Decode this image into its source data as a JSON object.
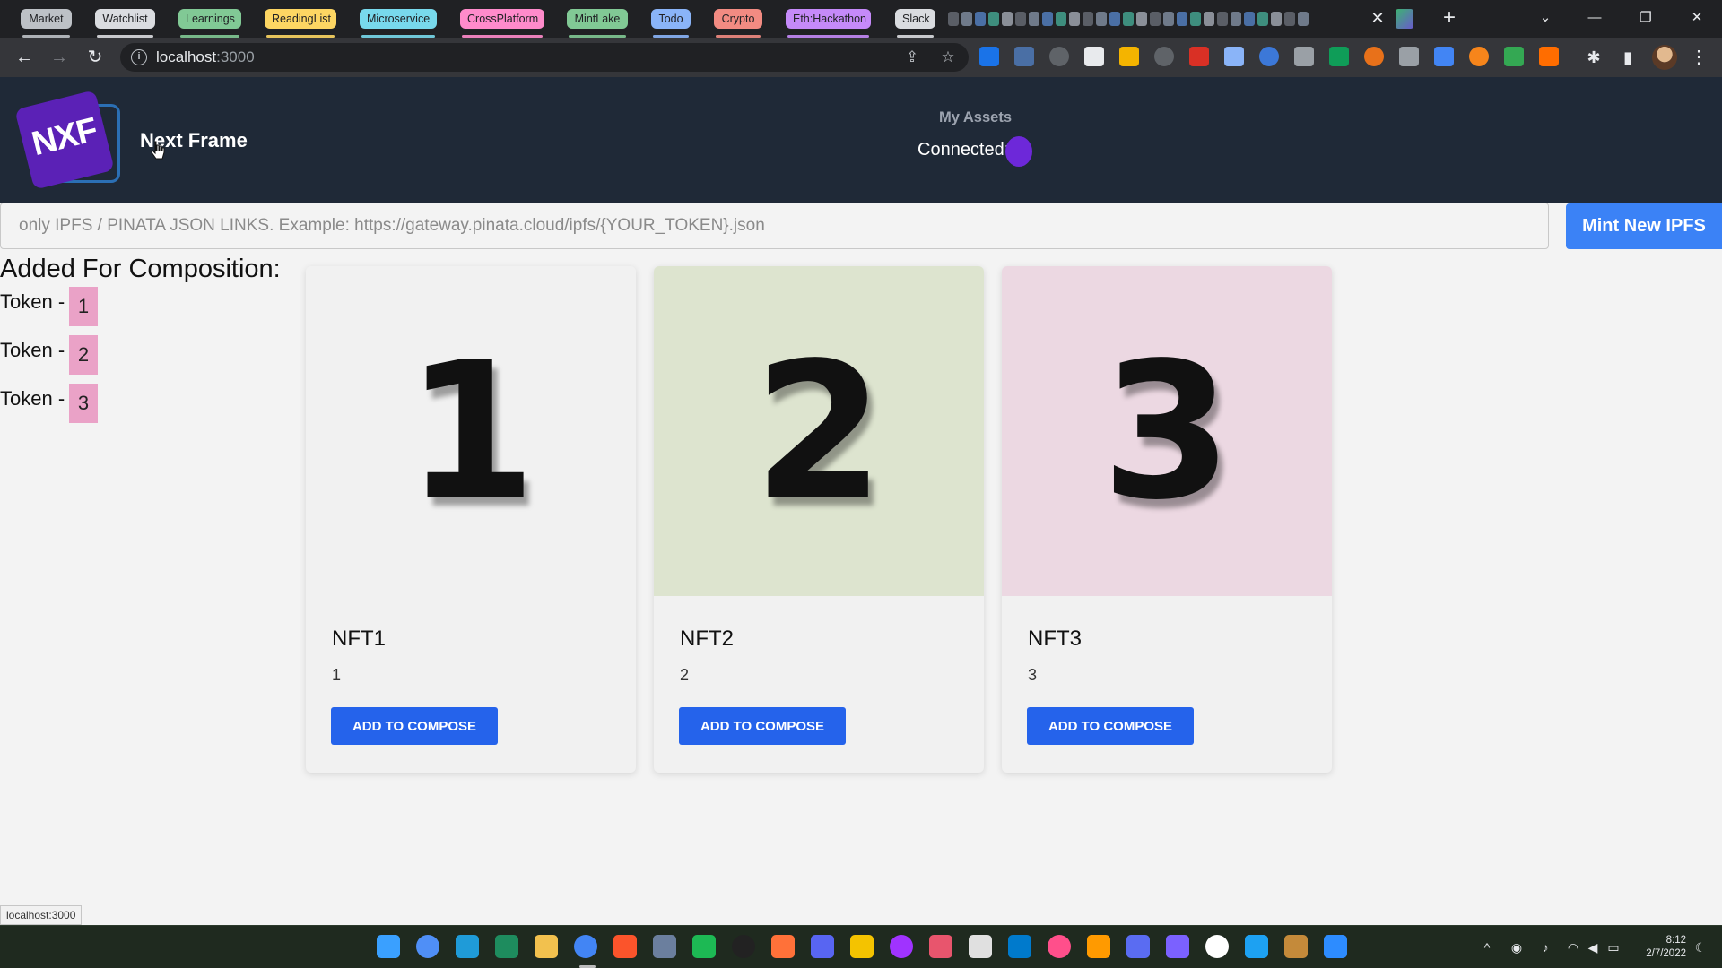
{
  "browser": {
    "tab_groups": [
      {
        "label": "Market",
        "color": "#bdc1c6",
        "text_color": "#202124"
      },
      {
        "label": "Watchlist",
        "color": "#dadce0",
        "text_color": "#202124"
      },
      {
        "label": "Learnings",
        "color": "#81c995",
        "text_color": "#202124"
      },
      {
        "label": "ReadingList",
        "color": "#fdd663",
        "text_color": "#202124"
      },
      {
        "label": "Microservice",
        "color": "#78d9ec",
        "text_color": "#202124"
      },
      {
        "label": "CrossPlatform",
        "color": "#ff8bcb",
        "text_color": "#202124"
      },
      {
        "label": "MintLake",
        "color": "#81c995",
        "text_color": "#202124"
      },
      {
        "label": "Todo",
        "color": "#8ab4f8",
        "text_color": "#202124"
      },
      {
        "label": "Crypto",
        "color": "#f28b82",
        "text_color": "#202124"
      },
      {
        "label": "Eth:Hackathon",
        "color": "#c58af9",
        "text_color": "#202124"
      },
      {
        "label": "Slack",
        "color": "#dadce0",
        "text_color": "#202124"
      }
    ],
    "address": {
      "host": "localhost",
      "port": ":3000"
    },
    "status_url": "localhost:3000"
  },
  "header": {
    "logo_text": "NXF",
    "brand_name": "Next Frame",
    "my_assets": "My Assets",
    "connected_label": "Connected:",
    "connected_color": "#6d28d9"
  },
  "mint": {
    "placeholder": "only IPFS / PINATA JSON LINKS. Example: https://gateway.pinata.cloud/ipfs/{YOUR_TOKEN}.json",
    "value": "",
    "button_label": "Mint New IPFS"
  },
  "composition": {
    "title": "Added For Composition:",
    "items": [
      {
        "label": "Token -",
        "token": "1"
      },
      {
        "label": "Token -",
        "token": "2"
      },
      {
        "label": "Token -",
        "token": "3"
      }
    ]
  },
  "nfts": [
    {
      "digit": "1",
      "name": "NFT1",
      "value": "1",
      "button": "ADD TO COMPOSE",
      "bg": "#f1f1f1"
    },
    {
      "digit": "2",
      "name": "NFT2",
      "value": "2",
      "button": "ADD TO COMPOSE",
      "bg": "#dde4cf"
    },
    {
      "digit": "3",
      "name": "NFT3",
      "value": "3",
      "button": "ADD TO COMPOSE",
      "bg": "#ecd8e2"
    }
  ],
  "taskbar": {
    "clock_time": "8:12",
    "clock_date": "2/7/2022"
  },
  "colors": {
    "header_bg": "#1f2937",
    "accent_blue": "#2563eb",
    "mint_button": "#3b82f6",
    "badge_pink": "#eaa2c7"
  }
}
